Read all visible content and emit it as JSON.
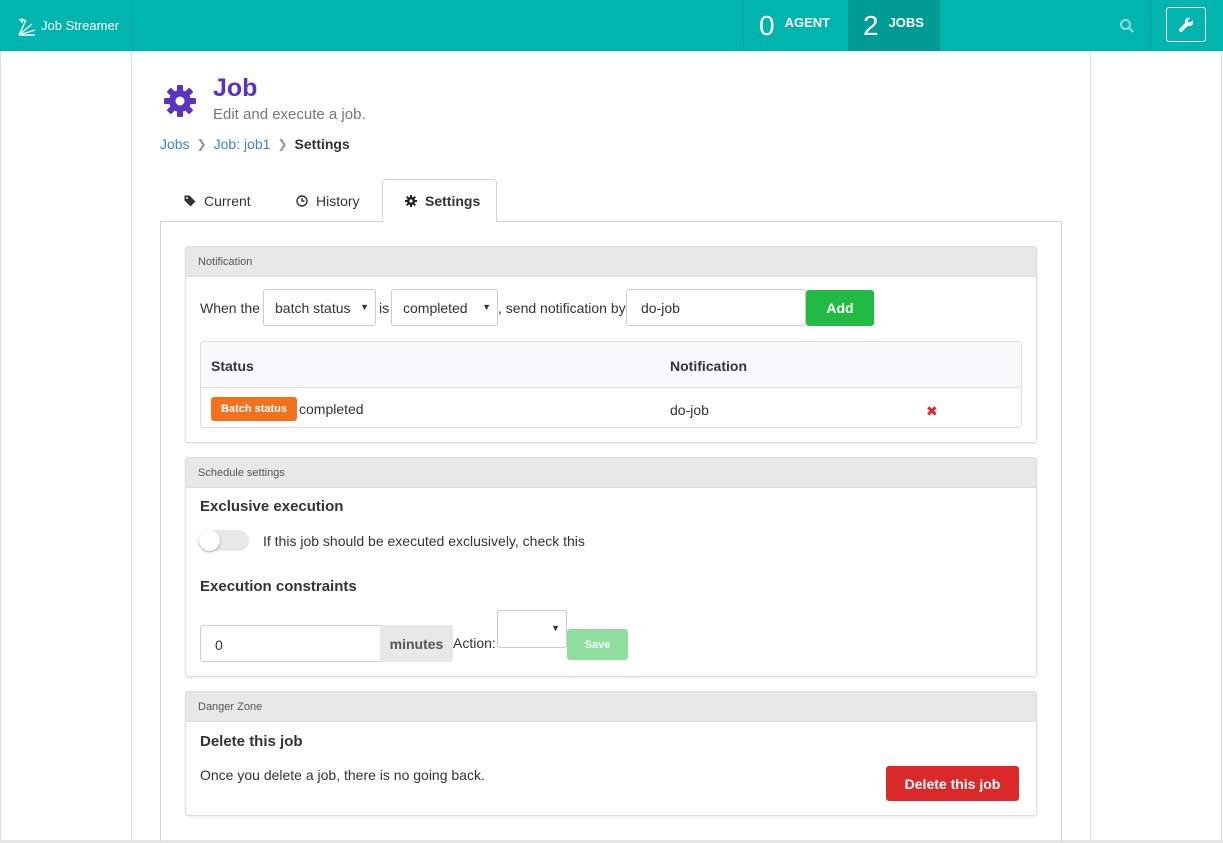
{
  "app": {
    "name": "Job Streamer",
    "logo_icon": "job-streamer-logo"
  },
  "topbar": {
    "agent": {
      "count": "0",
      "label": "AGENT"
    },
    "jobs": {
      "count": "2",
      "label": "JOBS"
    },
    "search_icon": "search-icon",
    "settings_icon": "wrench-icon"
  },
  "header": {
    "title": "Job",
    "subtitle": "Edit and execute a job.",
    "icon": "gear-icon"
  },
  "breadcrumb": [
    {
      "label": "Jobs"
    },
    {
      "label": "Job: job1"
    },
    {
      "label": "Settings"
    }
  ],
  "tabs": [
    {
      "label": "Current",
      "icon": "tag-icon"
    },
    {
      "label": "History",
      "icon": "clock-icon"
    },
    {
      "label": "Settings",
      "icon": "gear-icon",
      "active": true
    }
  ],
  "notification": {
    "heading": "Notification",
    "prefix": "When the",
    "field_select": "batch status",
    "connector": "is",
    "status_select": "completed",
    "suffix": ", send notification by",
    "notify_value": "do-job",
    "add_label": "Add",
    "table": {
      "headers": [
        "Status",
        "Notification"
      ],
      "rows": [
        {
          "badge": "Batch status",
          "value": "completed",
          "notification": "do-job",
          "delete_icon": "delete-icon"
        }
      ]
    }
  },
  "schedule": {
    "heading": "Schedule settings",
    "exclusive_title": "Exclusive execution",
    "exclusive_label": "If this job should be executed exclusively, check this",
    "exclusive_checked": false,
    "constraints_title": "Execution constraints",
    "minutes_value": "0",
    "minutes_unit": "minutes",
    "action_label": "Action:",
    "action_value": "",
    "save_label": "Save"
  },
  "danger": {
    "heading": "Danger Zone",
    "title": "Delete this job",
    "text": "Once you delete a job, there is no going back.",
    "button": "Delete this job"
  },
  "colors": {
    "topbar": "#00b5ad",
    "title": "#5b32c2",
    "add_button": "#21ba45",
    "badge": "#f2711c",
    "delete_button": "#db2828",
    "link": "#4183c4"
  }
}
